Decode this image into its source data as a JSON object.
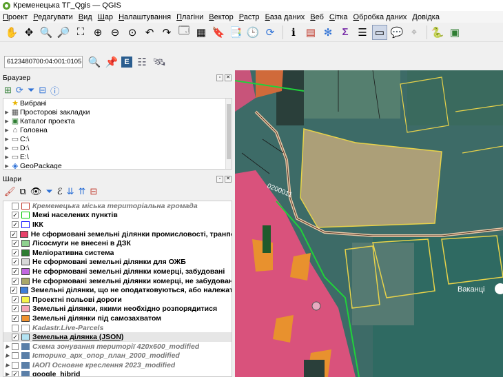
{
  "window": {
    "title": "Кременецька ТГ_Qgis — QGIS"
  },
  "menu": [
    "Проект",
    "Редагувати",
    "Вид",
    "Шар",
    "Налаштування",
    "Плагіни",
    "Вектор",
    "Растр",
    "База даних",
    "Веб",
    "Сітка",
    "Обробка даних",
    "Довідка"
  ],
  "search": {
    "value": "6123480700:04:001:0105"
  },
  "browser": {
    "title": "Браузер",
    "items": [
      {
        "label": "Вибрані",
        "icon": "star-icon"
      },
      {
        "label": "Просторові закладки",
        "icon": "bookmark-icon"
      },
      {
        "label": "Каталог проекта",
        "icon": "project-folder-icon"
      },
      {
        "label": "Головна",
        "icon": "home-folder-icon"
      },
      {
        "label": "C:\\",
        "icon": "drive-icon"
      },
      {
        "label": "D:\\",
        "icon": "drive-icon"
      },
      {
        "label": "E:\\",
        "icon": "drive-icon"
      },
      {
        "label": "GeoPackage",
        "icon": "geopackage-icon"
      }
    ]
  },
  "layers": {
    "title": "Шари",
    "items": [
      {
        "label": "Кременецька міська територіальна громада",
        "checked": false,
        "italic": true,
        "swatch_fill": "#ffffff",
        "swatch_border": "#c0392b"
      },
      {
        "label": "Межі населених пунктів",
        "checked": true,
        "italic": false,
        "swatch_fill": "#ffffff",
        "swatch_border": "#00c800"
      },
      {
        "label": "ІКК",
        "checked": true,
        "italic": false,
        "swatch_fill": "#ffffff",
        "swatch_border": "#1a1aff"
      },
      {
        "label": "Не сформовані земельні ділянки промисловості, транпорту та зв",
        "checked": true,
        "italic": false,
        "swatch_fill": "#e8416a",
        "swatch_border": "#444444"
      },
      {
        "label": "Лісосмуги не внесені в ДЗК",
        "checked": true,
        "italic": false,
        "swatch_fill": "#8fd18f",
        "swatch_border": "#444444"
      },
      {
        "label": "Меліоративна система",
        "checked": true,
        "italic": false,
        "swatch_fill": "#2e7d32",
        "swatch_border": "#444444"
      },
      {
        "label": "Не сформовані земельні ділянки для ОЖБ",
        "checked": true,
        "italic": false,
        "swatch_fill": "#d8d8d8",
        "swatch_border": "#444444"
      },
      {
        "label": "Не сформовані земельні ділянки комерці, забудовані",
        "checked": true,
        "italic": false,
        "swatch_fill": "#c266e0",
        "swatch_border": "#444444"
      },
      {
        "label": "Не сформовані земельні ділянки комерці, не забудовані",
        "checked": true,
        "italic": false,
        "swatch_fill": "#a9a86a",
        "swatch_border": "#444444"
      },
      {
        "label": "Земельні ділянки, що не оподатковуються, або належать до пільг",
        "checked": true,
        "italic": false,
        "swatch_fill": "#3f7fd8",
        "swatch_border": "#444444"
      },
      {
        "label": "Проектні польові дороги",
        "checked": true,
        "italic": false,
        "swatch_fill": "#f5f54a",
        "swatch_border": "#444444"
      },
      {
        "label": "Земельні ділянки, якими необхідно розпорядитися",
        "checked": true,
        "italic": false,
        "swatch_fill": "#f4a6b6",
        "swatch_border": "#444444"
      },
      {
        "label": "Земельні ділянки під самозахватом",
        "checked": true,
        "italic": false,
        "swatch_fill": "#f0912e",
        "swatch_border": "#444444"
      },
      {
        "label": "Kadastr.Live-Parcels",
        "checked": false,
        "italic": true,
        "swatch_fill": "#ffffff",
        "swatch_border": "#888888"
      },
      {
        "label": "Земельна ділянка (JSON)",
        "checked": true,
        "italic": false,
        "swatch_fill": "#b3e3f2",
        "swatch_border": "#444444"
      },
      {
        "label": "Схема зонування території 420х600_modified",
        "checked": false,
        "italic": true,
        "swatch_fill": "#5a7fa8",
        "swatch_border": "#5a7fa8"
      },
      {
        "label": "Історико_арх_опор_план_2000_modified",
        "checked": false,
        "italic": true,
        "swatch_fill": "#5a7fa8",
        "swatch_border": "#5a7fa8"
      },
      {
        "label": "ІАОП Основне креслення 2023_modified",
        "checked": false,
        "italic": true,
        "swatch_fill": "#5a7fa8",
        "swatch_border": "#5a7fa8"
      },
      {
        "label": "google_hibrid",
        "checked": true,
        "italic": false,
        "swatch_fill": "#5a7fa8",
        "swatch_border": "#5a7fa8"
      }
    ]
  },
  "map": {
    "road_label": "0200011",
    "place_label": "Ваканці"
  }
}
